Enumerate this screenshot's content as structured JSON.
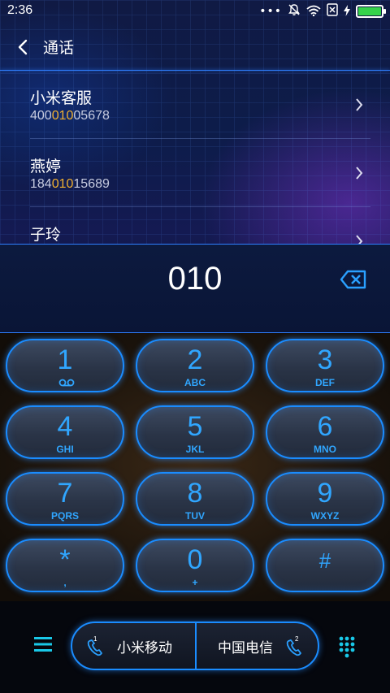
{
  "status_bar": {
    "time": "2:36"
  },
  "header": {
    "title": "通话"
  },
  "contacts": [
    {
      "name": "小米客服",
      "number_pre": "400",
      "number_match": "010",
      "number_post": "05678"
    },
    {
      "name": "燕婷",
      "number_pre": "184",
      "number_match": "010",
      "number_post": "15689"
    },
    {
      "name": "子玲",
      "number_pre": "",
      "number_match": "",
      "number_post": ""
    }
  ],
  "input": {
    "digits": "010"
  },
  "keypad": [
    {
      "digit": "1",
      "letters": ""
    },
    {
      "digit": "2",
      "letters": "ABC"
    },
    {
      "digit": "3",
      "letters": "DEF"
    },
    {
      "digit": "4",
      "letters": "GHI"
    },
    {
      "digit": "5",
      "letters": "JKL"
    },
    {
      "digit": "6",
      "letters": "MNO"
    },
    {
      "digit": "7",
      "letters": "PQRS"
    },
    {
      "digit": "8",
      "letters": "TUV"
    },
    {
      "digit": "9",
      "letters": "WXYZ"
    },
    {
      "digit": "*",
      "letters": ","
    },
    {
      "digit": "0",
      "letters": "+"
    },
    {
      "digit": "#",
      "letters": ""
    }
  ],
  "bottom_bar": {
    "sim1": {
      "label": "小米移动",
      "slot": "1"
    },
    "sim2": {
      "label": "中国电信",
      "slot": "2"
    }
  },
  "colors": {
    "accent": "#1a8cff",
    "highlight": "#f0b030",
    "battery": "#35d24a"
  }
}
